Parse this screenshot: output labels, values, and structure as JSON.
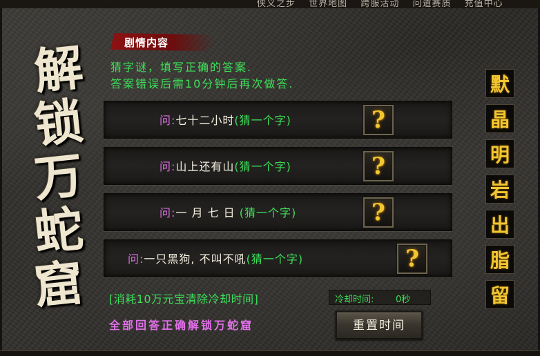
{
  "top_nav": [
    "侠义之步",
    "世界地图",
    "跨服活动",
    "问道赛质",
    "充值中心"
  ],
  "title_chars": [
    "解",
    "锁",
    "万",
    "蛇",
    "窟"
  ],
  "section_tab": "剧情内容",
  "instructions": [
    "猜字谜，填写正确的答案.",
    "答案错误后需10分钟后再次做答."
  ],
  "questions": [
    {
      "prefix": "问:",
      "body": "七十二小时",
      "hint": "(猜一个字)",
      "button": "?"
    },
    {
      "prefix": "问:",
      "body": "山上还有山",
      "hint": "(猜一个字)",
      "button": "?"
    },
    {
      "prefix": "问:",
      "body": "一 月 七 日 ",
      "hint": "(猜一个字)",
      "button": "?"
    },
    {
      "prefix": "问:",
      "body": "一只黑狗, 不叫不吼",
      "hint": "(猜一个字)",
      "button": "?"
    }
  ],
  "cost_text": "[消耗10万元宝清除冷却时间]",
  "cooldown": {
    "label": "冷却时间:",
    "value": "0秒"
  },
  "unlock_text": "全部回答正确解锁万蛇窟",
  "reset_button": "重置时间",
  "answer_chars": [
    "默",
    "晶",
    "明",
    "岩",
    "出",
    "脂",
    "留"
  ],
  "colors": {
    "accent_green": "#3ee05a",
    "prefix_magenta": "#e070e8",
    "answer_gold": "#f2c632",
    "tab_red": "#8e1212"
  }
}
